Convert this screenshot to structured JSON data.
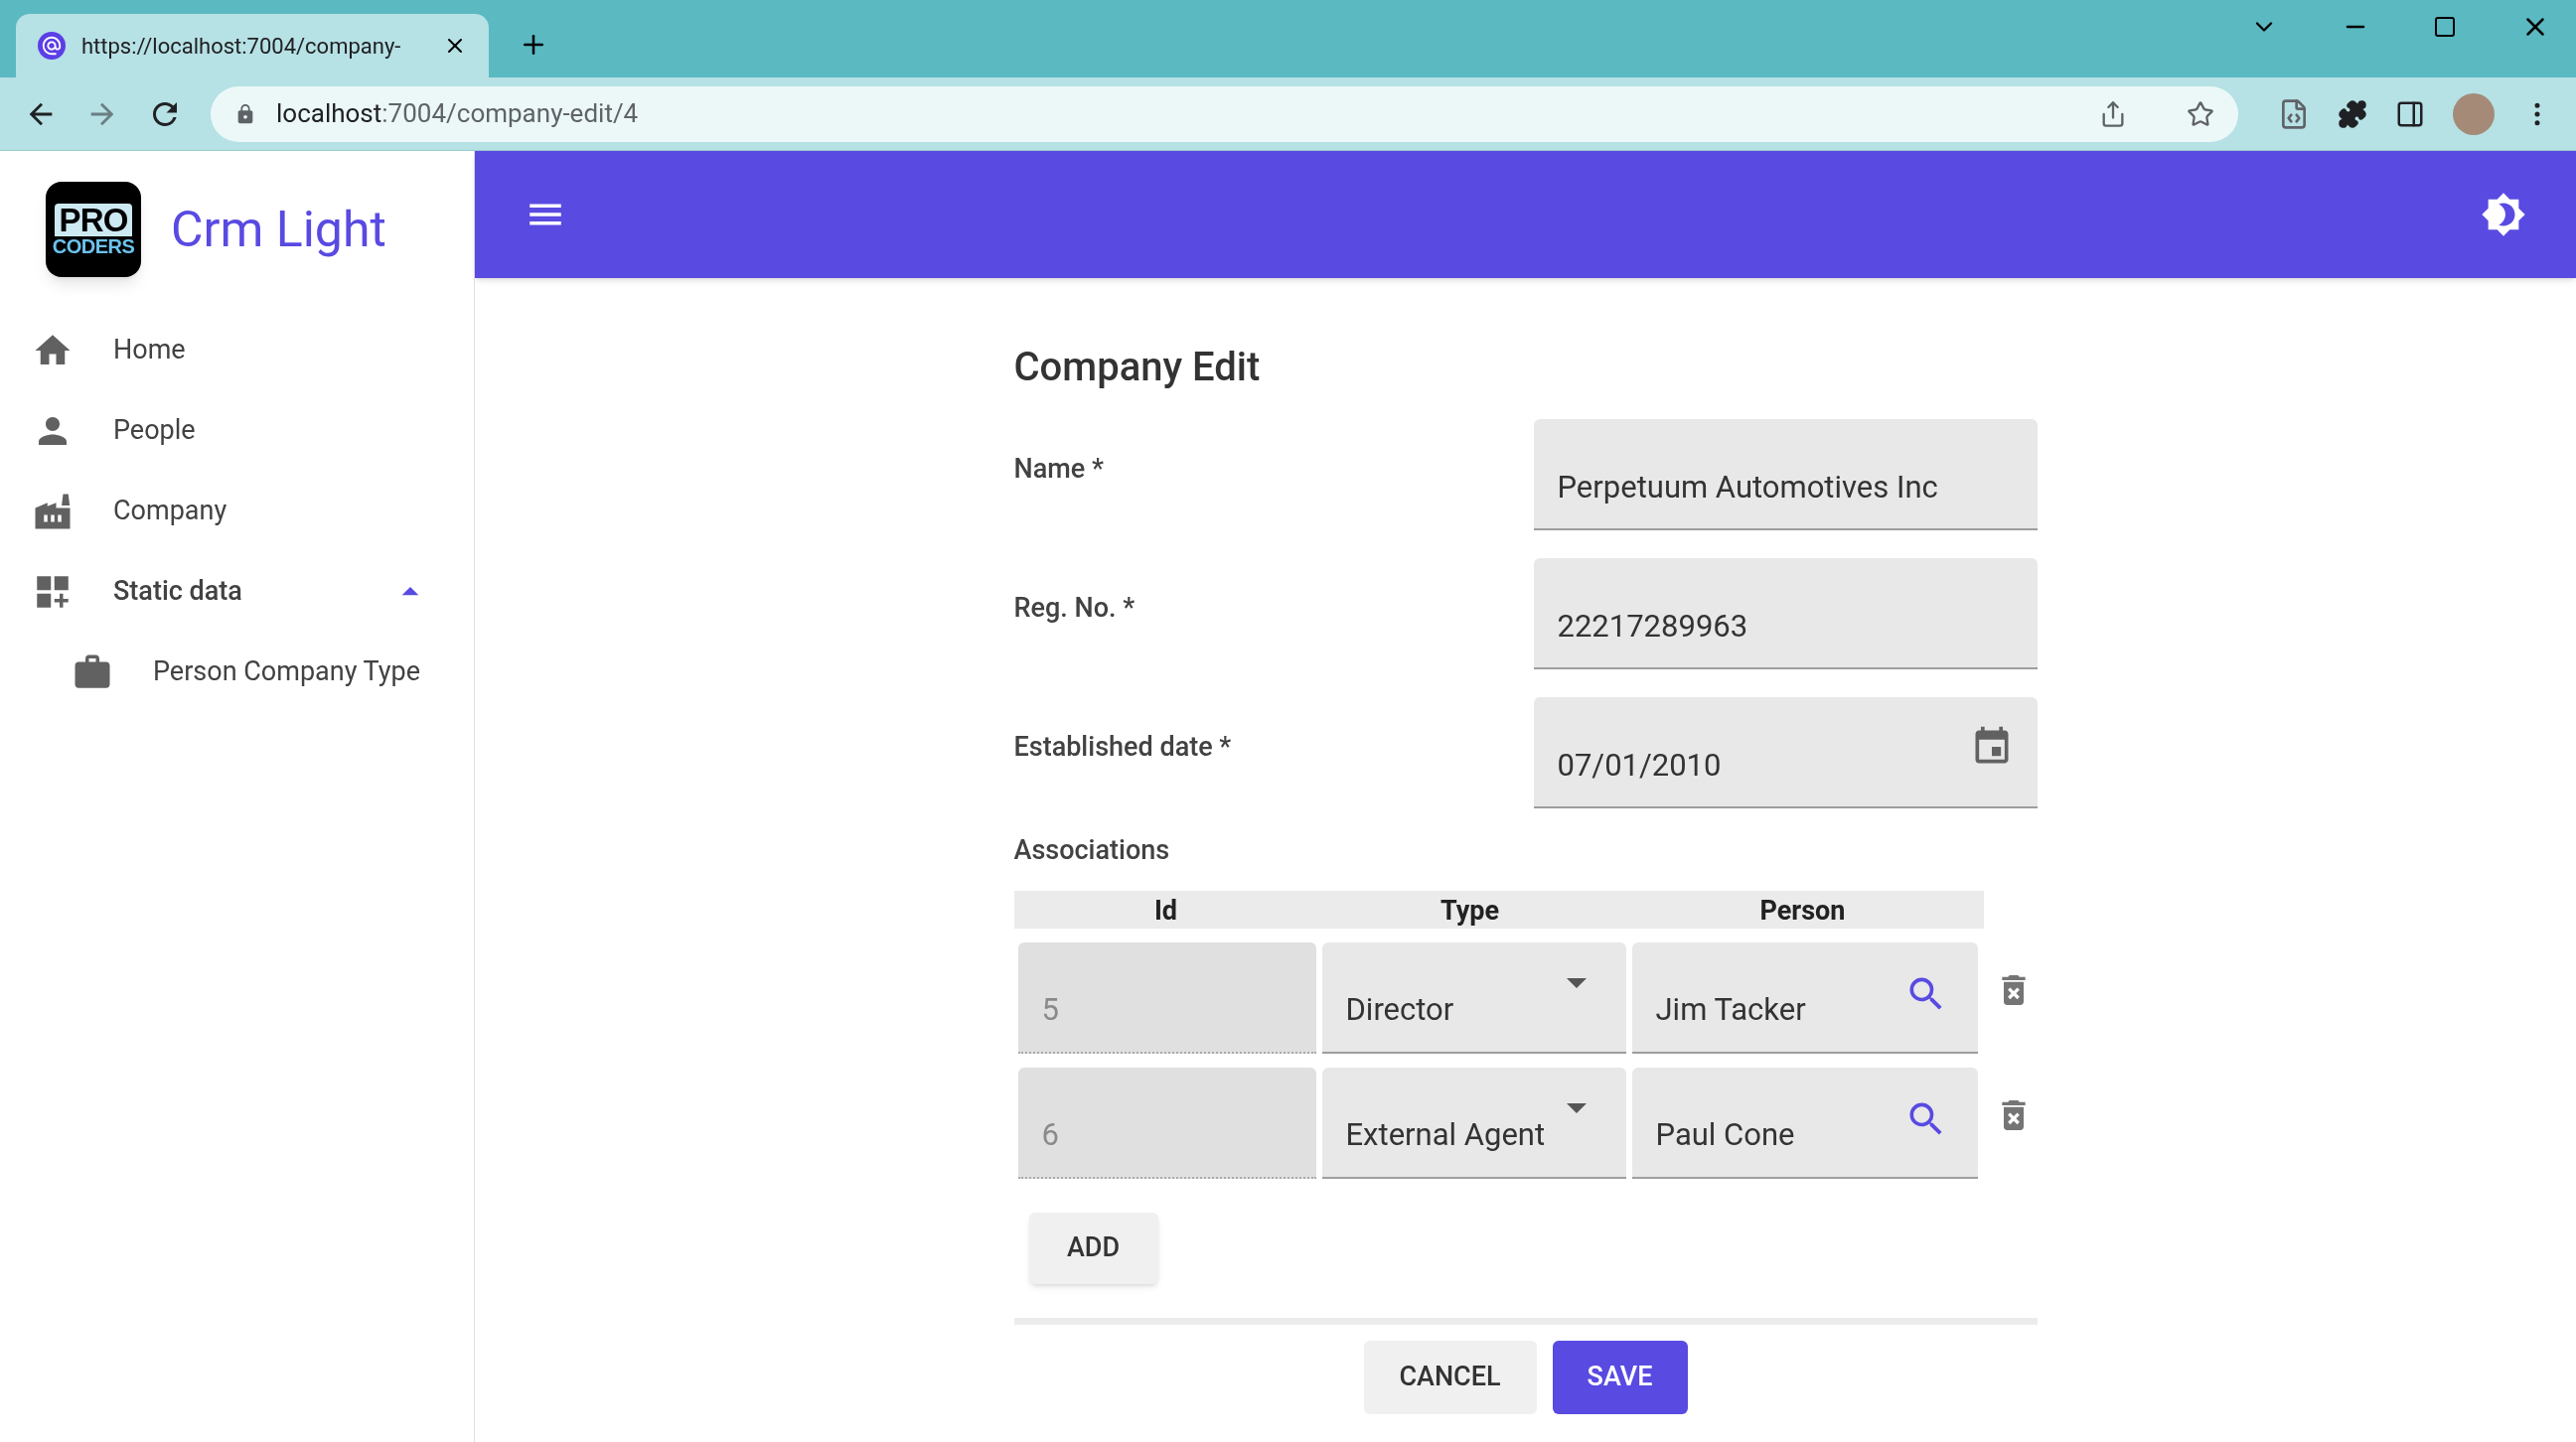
{
  "browser": {
    "tab_title": "https://localhost:7004/company-",
    "url_host": "localhost",
    "url_path": ":7004/company-edit/4"
  },
  "sidebar": {
    "logo": {
      "line1": "PRO",
      "line2": "CODERS"
    },
    "app_title": "Crm Light",
    "items": [
      {
        "kind": "home",
        "label": "Home"
      },
      {
        "kind": "person",
        "label": "People"
      },
      {
        "kind": "factory",
        "label": "Company"
      },
      {
        "kind": "widgets",
        "label": "Static data",
        "expanded": true,
        "children": [
          {
            "kind": "briefcase",
            "label": "Person Company Type"
          }
        ]
      }
    ]
  },
  "form": {
    "title": "Company Edit",
    "fields": [
      {
        "kind": "text",
        "label": "Name *",
        "value": "Perpetuum Automotives Inc"
      },
      {
        "kind": "text",
        "label": "Reg. No. *",
        "value": "22217289963"
      },
      {
        "kind": "date",
        "label": "Established date *",
        "value": "07/01/2010"
      }
    ],
    "associations": {
      "label": "Associations",
      "columns": [
        "Id",
        "Type",
        "Person"
      ],
      "rows": [
        {
          "id": "5",
          "type": "Director",
          "person": "Jim Tacker"
        },
        {
          "id": "6",
          "type": "External Agent",
          "person": "Paul Cone"
        }
      ],
      "add_button": "ADD"
    },
    "cancel_button": "CANCEL",
    "save_button": "SAVE"
  }
}
